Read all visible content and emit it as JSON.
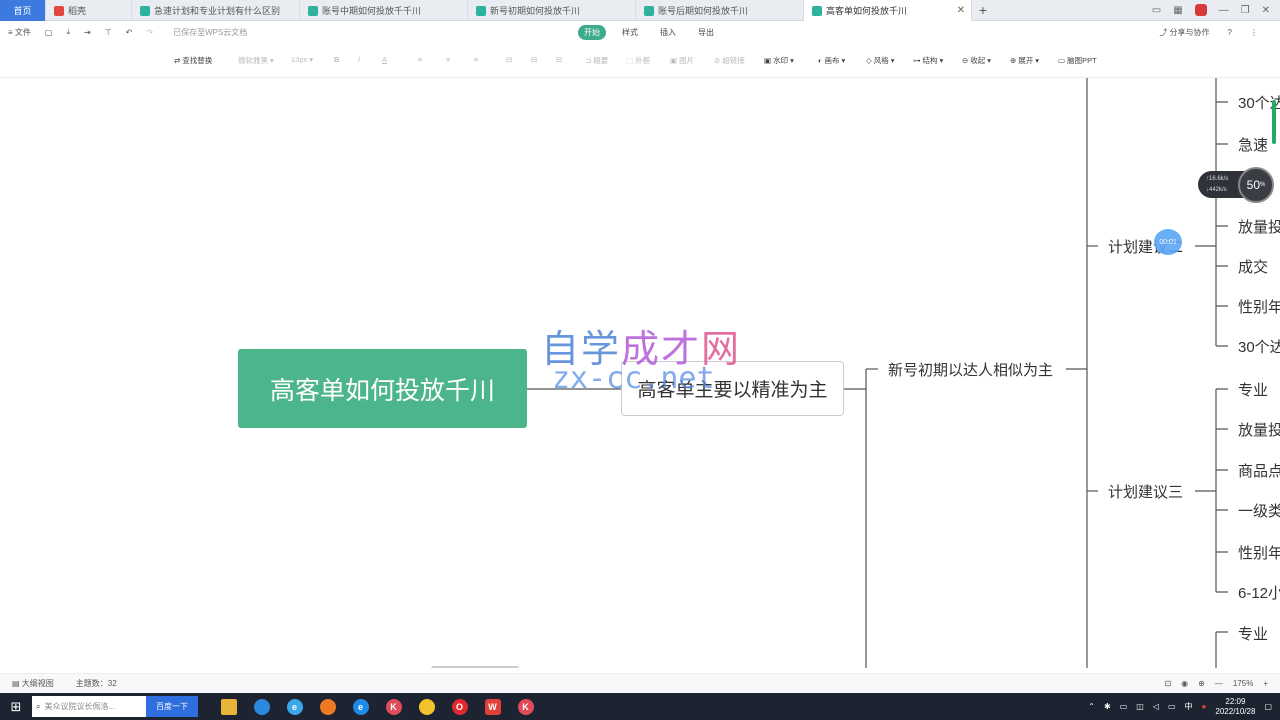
{
  "tabs": [
    {
      "label": "首页",
      "kind": "home"
    },
    {
      "label": "稻壳",
      "kind": "red"
    },
    {
      "label": "急速计划和专业计划有什么区别",
      "kind": "teal"
    },
    {
      "label": "账号中期如何投放千千川",
      "kind": "teal"
    },
    {
      "label": "新号初期如何投放千川",
      "kind": "teal"
    },
    {
      "label": "账号后期如何投放千川",
      "kind": "teal"
    },
    {
      "label": "高客单如何投放千川",
      "kind": "teal",
      "active": true
    }
  ],
  "menu": {
    "file": "文件",
    "saved": "已保存至WPS云文档",
    "tabs": [
      "开始",
      "样式",
      "插入",
      "导出"
    ],
    "active_tab": "开始",
    "share": "分享与协作",
    "help": "?"
  },
  "toolbar": {
    "find_replace": "查找替换",
    "font": "微软雅黑",
    "font_size": "13px",
    "bold": "B",
    "italic": "I",
    "color": "A",
    "summary": "概要",
    "frame": "外框",
    "image": "图片",
    "link": "超链接",
    "watermark": "水印",
    "canvas": "画布",
    "style": "风格",
    "structure": "结构",
    "collapse": "收起",
    "expand": "展开",
    "ppt": "脑图PPT"
  },
  "mindmap": {
    "root": "高客单如何投放千川",
    "sub1": "高客单主要以精准为主",
    "branch": "新号初期以达人相似为主",
    "plan2": "计划建议二",
    "plan3": "计划建议三",
    "leaves_top": [
      "30个达",
      "急速",
      "放量投",
      "成交",
      "性别年",
      "30个达"
    ],
    "leaves_mid": [
      "专业",
      "放量投",
      "商品点",
      "一级类",
      "性别年",
      "6-12小"
    ],
    "leaves_bot": [
      "专业"
    ]
  },
  "watermark": {
    "line1a": "自学",
    "line1b": "成才",
    "line1c": "网",
    "line2": "zx-cc.net"
  },
  "overlay": {
    "speed_up": "↑16.6k/s",
    "speed_down": "↓442k/s",
    "percent": "50",
    "timer": "00:01"
  },
  "status": {
    "outline": "大纲视图",
    "topics": "主题数：32",
    "zoom": "175%"
  },
  "taskbar": {
    "search_placeholder": "美众议院议长佩洛...",
    "search_btn": "百度一下",
    "time": "22:09",
    "date": "2022/10/28",
    "ime": "中"
  }
}
